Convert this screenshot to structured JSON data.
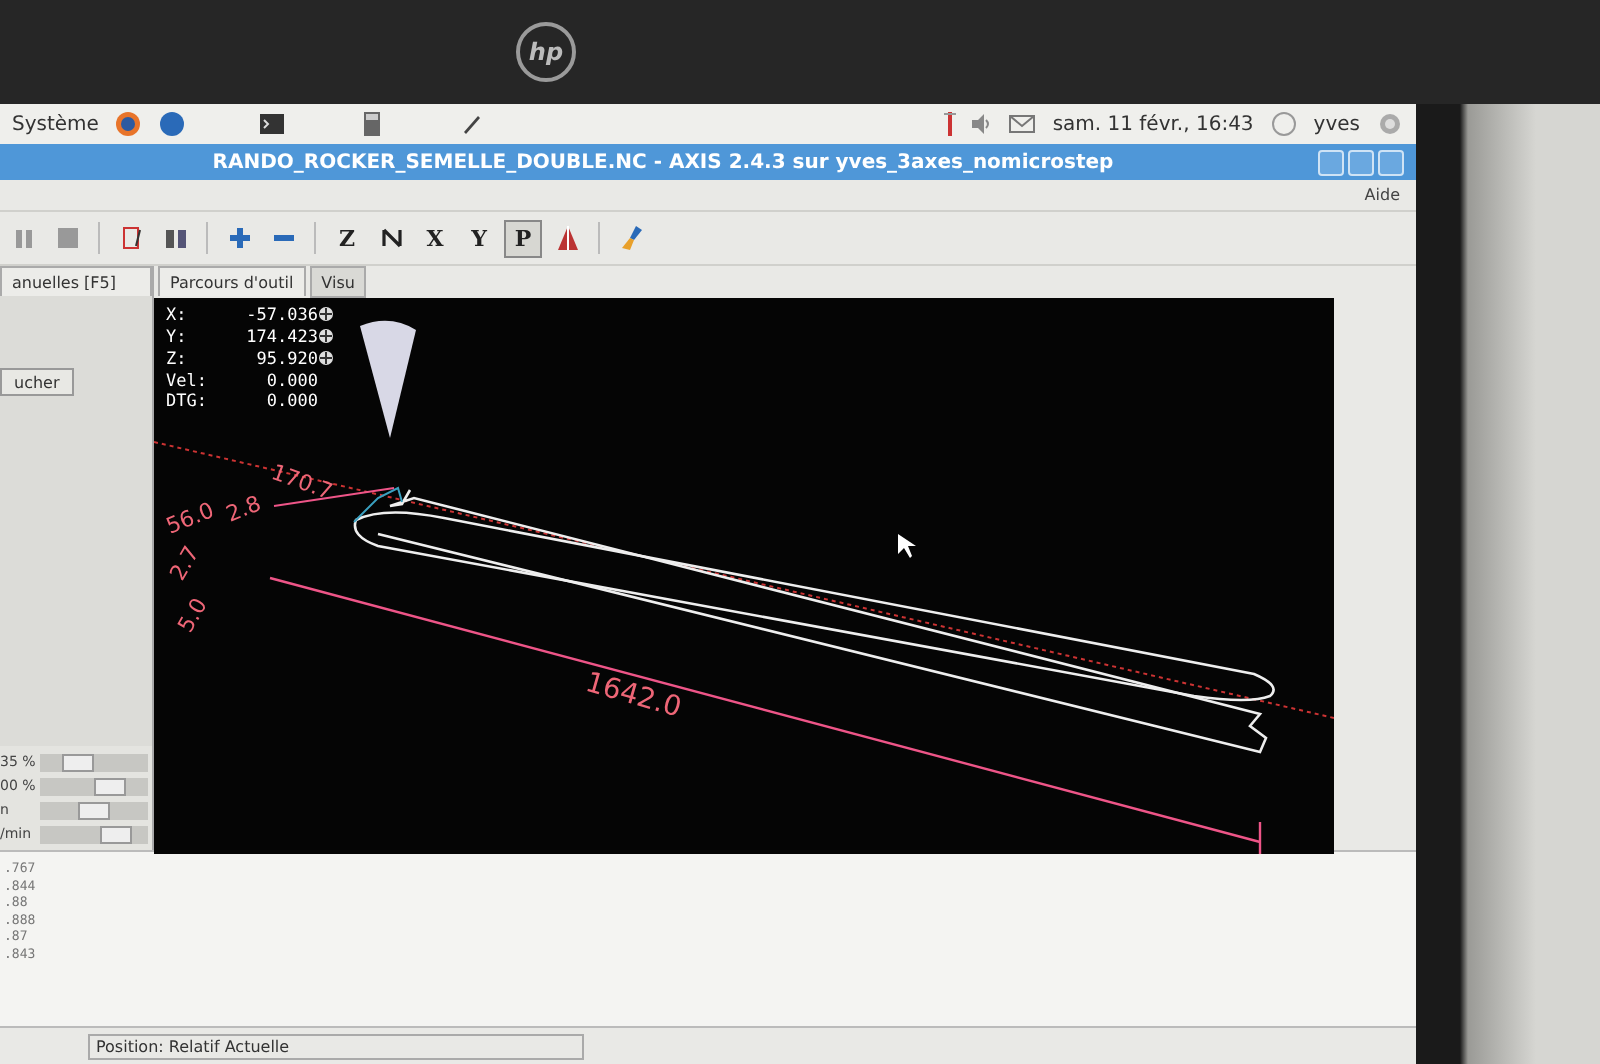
{
  "bezel": {
    "logo": "hp"
  },
  "top_panel": {
    "menu": "Système",
    "clock": "sam. 11 févr., 16:43",
    "user": "yves"
  },
  "window": {
    "title": "RANDO_ROCKER_SEMELLE_DOUBLE.NC - AXIS 2.4.3 sur yves_3axes_nomicrostep"
  },
  "menu_bar": [
    "Aide"
  ],
  "view_buttons": [
    {
      "label": "Z",
      "selected": false
    },
    {
      "label": "X",
      "selected": false
    },
    {
      "label": "Y",
      "selected": false
    },
    {
      "label": "P",
      "selected": true
    }
  ],
  "left_panel": {
    "tab": "anuelles [F5]",
    "button": "ucher",
    "sliders": [
      {
        "label": "35 %",
        "level": 0.3
      },
      {
        "label": "00 %",
        "level": 0.72
      },
      {
        "label": "n",
        "level": 0.5
      },
      {
        "label": "/min",
        "level": 0.8
      }
    ]
  },
  "tabs": [
    {
      "label": "Parcours d'outil",
      "selected": true
    },
    {
      "label": "Visu",
      "selected": false
    }
  ],
  "dro": [
    {
      "axis": "X:",
      "value": "-57.036",
      "homed": true
    },
    {
      "axis": "Y:",
      "value": "174.423",
      "homed": true
    },
    {
      "axis": "Z:",
      "value": "95.920",
      "homed": true
    },
    {
      "axis": "Vel:",
      "value": "0.000",
      "homed": false
    },
    {
      "axis": "DTG:",
      "value": "0.000",
      "homed": false
    }
  ],
  "preview": {
    "labels": [
      "170.7",
      "56.0",
      "2.8",
      "2.7",
      "5.0",
      "1642.0"
    ]
  },
  "gcode_lines": [
    ".767",
    ".844",
    ".88",
    ".888",
    ".87",
    ".843"
  ],
  "status_bar": {
    "position": "Position: Relatif Actuelle"
  }
}
